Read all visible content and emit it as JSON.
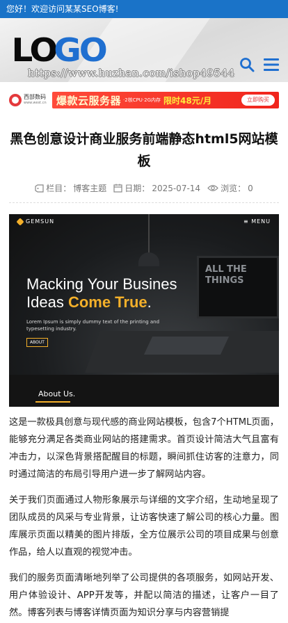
{
  "topbar": {
    "greeting": "您好！欢迎访问某某SEO博客!"
  },
  "header": {
    "logo_left": "LO",
    "logo_right": "GO",
    "watermark": "https://www.huzhan.com/ishop49544"
  },
  "ad": {
    "brand_name": "西部数码",
    "brand_url": "www.west.cn",
    "headline": "爆款云服务器",
    "spec": "·2核CPU·2G内存",
    "price": "限时48元/月",
    "cta": "立即购买"
  },
  "article": {
    "title": "黑色创意设计商业服务前端静态html5网站模板",
    "meta": {
      "category_label": "栏目：",
      "category": "博客主题",
      "date_label": "日期：",
      "date": "2025-07-14",
      "views_label": "浏览：",
      "views": "0"
    },
    "hero": {
      "brand": "GEMSUN",
      "menu": "≡ MENU",
      "headline_1": "Macking Your Busines",
      "headline_2a": "Ideas ",
      "headline_2b": "Come True",
      "headline_2c": ".",
      "sub": "Lorem Ipsum is simply dummy text of the printing and typesetting industry.",
      "button": "ABOUT",
      "monitor_text": "ALL THE THINGS",
      "about": "About Us."
    },
    "paragraphs": [
      "这是一款极具创意与现代感的商业网站模板，包含7个HTML页面，能够充分满足各类商业网站的搭建需求。首页设计简洁大气且富有冲击力，以深色背景搭配醒目的标题，瞬间抓住访客的注意力，同时通过简洁的布局引导用户进一步了解网站内容。",
      "关于我们页面通过人物形象展示与详细的文字介绍，生动地呈现了团队成员的风采与专业背景，让访客快速了解公司的核心力量。图库展示页面以精美的图片排版，全方位展示公司的项目成果与创意作品，给人以直观的视觉冲击。",
      "我们的服务页面清晰地列举了公司提供的各项服务，如网站开发、用户体验设计、APP开发等，并配以简洁的描述，让客户一目了然。博客列表与博客详情页面为知识分享与内容营销提"
    ]
  }
}
